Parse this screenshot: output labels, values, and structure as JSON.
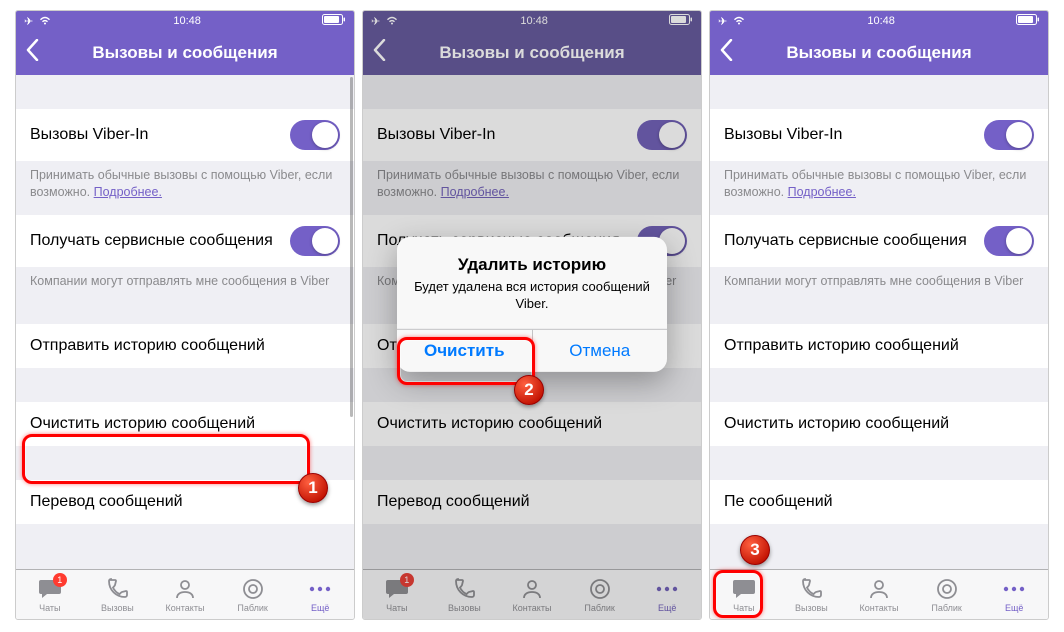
{
  "status": {
    "time": "10:48"
  },
  "nav": {
    "title": "Вызовы и сообщения"
  },
  "settings": {
    "viber_in": {
      "label": "Вызовы Viber-In"
    },
    "viber_in_footer": {
      "text": "Принимать обычные вызовы с помощью Viber, если возможно. ",
      "link": "Подробнее."
    },
    "service_msgs": {
      "label": "Получать сервисные сообщения"
    },
    "service_msgs_footer": {
      "text": "Компании могут отправлять мне сообщения в Viber"
    },
    "send_history": {
      "label": "Отправить историю сообщений"
    },
    "clear_history": {
      "label": "Очистить историю сообщений"
    },
    "translate": {
      "label": "Перевод сообщений"
    },
    "translate_cut": {
      "label": "Пе            сообщений"
    }
  },
  "alert": {
    "title": "Удалить историю",
    "message": "Будет удалена вся история сообщений Viber.",
    "confirm": "Очистить",
    "cancel": "Отмена"
  },
  "tabs": {
    "chats": "Чаты",
    "calls": "Вызовы",
    "contacts": "Контакты",
    "public": "Паблик",
    "more": "Ещё",
    "badge": "1"
  },
  "callouts": {
    "n1": "1",
    "n2": "2",
    "n3": "3"
  }
}
